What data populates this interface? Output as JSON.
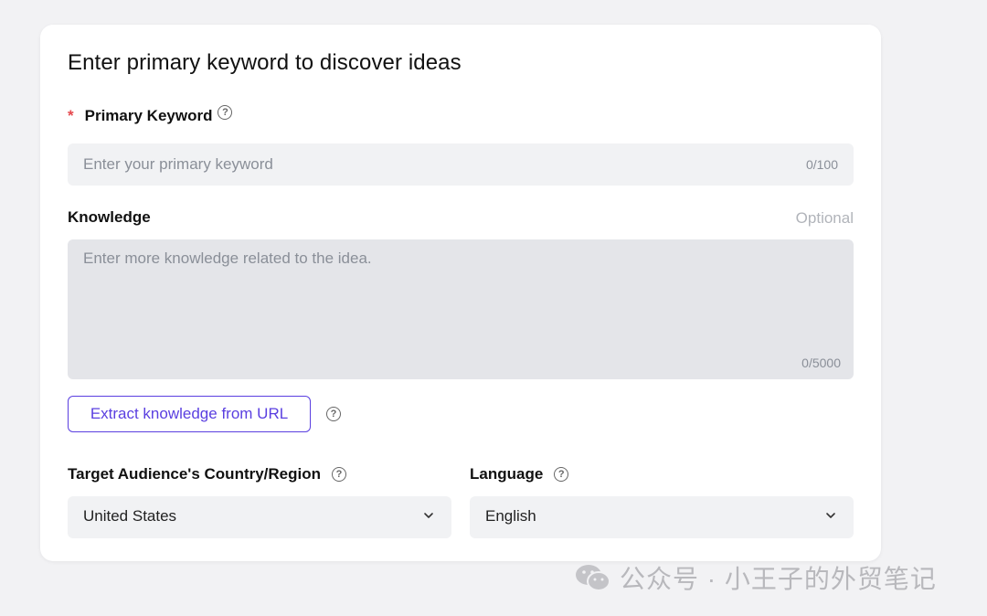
{
  "form": {
    "title": "Enter primary keyword to discover ideas",
    "primary_keyword": {
      "required_mark": "*",
      "label": "Primary Keyword",
      "placeholder": "Enter your primary keyword",
      "counter": "0/100"
    },
    "knowledge": {
      "label": "Knowledge",
      "optional_text": "Optional",
      "placeholder": "Enter more knowledge related to the idea.",
      "counter": "0/5000"
    },
    "extract_button_label": "Extract knowledge from URL",
    "country": {
      "label": "Target Audience's Country/Region",
      "value": "United States"
    },
    "language": {
      "label": "Language",
      "value": "English"
    },
    "help_glyph": "?"
  },
  "watermark": {
    "text": "公众号 · 小王子的外贸笔记",
    "icon": "wechat-icon"
  },
  "colors": {
    "accent": "#5a3fe0",
    "required": "#e5484d",
    "input_bg": "#f1f2f4",
    "page_bg": "#f2f2f4"
  }
}
